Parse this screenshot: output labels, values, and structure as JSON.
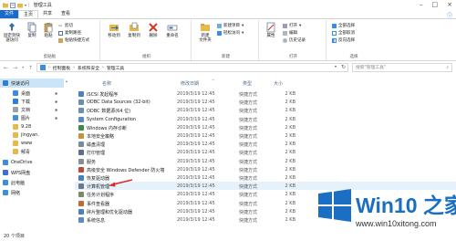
{
  "window": {
    "title": "管理工具"
  },
  "tabs": [
    {
      "label": "文件"
    },
    {
      "label": "主页"
    },
    {
      "label": "共享"
    },
    {
      "label": "查看"
    }
  ],
  "ribbon": {
    "pin_quick_access": "固定到快\n速访问",
    "copy": "复制",
    "paste": "粘贴",
    "cut": "剪切",
    "copy_path": "复制路径",
    "paste_shortcut": "粘贴快捷方式",
    "group_clipboard": "剪贴板",
    "move_to": "移动到",
    "copy_to": "复制到",
    "delete": "删除",
    "rename": "重命名",
    "group_organize": "组织",
    "new_folder": "新建\n文件夹",
    "new_item": "新建项目",
    "easy_access": "轻松访问",
    "group_new": "新建",
    "properties": "属性",
    "open": "打开",
    "edit": "编辑",
    "history": "历史记录",
    "group_open": "打开",
    "select_all": "全部选择",
    "select_none": "全部取消",
    "invert_selection": "反向选择",
    "group_select": "选择"
  },
  "address": {
    "crumbs": [
      "控制面板",
      "系统和安全",
      "管理工具"
    ]
  },
  "search": {
    "placeholder": "搜索\"管理工具\""
  },
  "nav_pane": [
    {
      "label": "快速访问",
      "selected": true,
      "icon": "star-icon",
      "color": "#2f80d1"
    },
    {
      "label": "桌面",
      "pinned": true,
      "icon": "desktop-icon",
      "color": "#3a8ee0"
    },
    {
      "label": "下载",
      "pinned": true,
      "icon": "download-icon",
      "color": "#2f80d1"
    },
    {
      "label": "文档",
      "pinned": true,
      "icon": "document-icon",
      "color": "#9aa3ad"
    },
    {
      "label": "图片",
      "pinned": true,
      "icon": "picture-icon",
      "color": "#4a90d0"
    },
    {
      "label": "9.28",
      "icon": "folder-icon",
      "color": "#e8b84a"
    },
    {
      "label": "jingyan.",
      "icon": "folder-icon",
      "color": "#e8b84a"
    },
    {
      "label": "www",
      "icon": "folder-icon",
      "color": "#e8b84a"
    },
    {
      "label": "郁青",
      "icon": "folder-icon",
      "color": "#e8b84a"
    },
    {
      "label": "OneDrive",
      "icon": "cloud-icon",
      "color": "#3a8ee0"
    },
    {
      "label": "WPS网盘",
      "icon": "cloud-icon",
      "color": "#3b6fd8"
    },
    {
      "label": "此电脑",
      "icon": "computer-icon",
      "color": "#3a8ee0"
    },
    {
      "label": "网络",
      "icon": "network-icon",
      "color": "#3a8ee0"
    }
  ],
  "columns": {
    "name": "名称",
    "date": "修改日期",
    "type": "类型",
    "size": "大小"
  },
  "files": [
    {
      "name": "iSCSI 发起程序",
      "date": "2019/3/19 12:45",
      "type": "快捷方式",
      "size": "2 KB",
      "color": "#4f7fbf"
    },
    {
      "name": "ODBC Data Sources (32-bit)",
      "date": "2019/3/19 12:45",
      "type": "快捷方式",
      "size": "2 KB",
      "color": "#6b8fb0"
    },
    {
      "name": "ODBC 数据源(64 位)",
      "date": "2019/3/19 12:45",
      "type": "快捷方式",
      "size": "2 KB",
      "color": "#6b8fb0"
    },
    {
      "name": "System Configuration",
      "date": "2019/3/19 12:45",
      "type": "快捷方式",
      "size": "2 KB",
      "color": "#5a89c4"
    },
    {
      "name": "Windows 内存诊断",
      "date": "2019/3/19 12:45",
      "type": "快捷方式",
      "size": "2 KB",
      "color": "#3f8a4e"
    },
    {
      "name": "本地安全策略",
      "date": "2019/3/19 12:45",
      "type": "快捷方式",
      "size": "2 KB",
      "color": "#c0983a"
    },
    {
      "name": "磁盘清理",
      "date": "2019/3/19 12:45",
      "type": "快捷方式",
      "size": "2 KB",
      "color": "#7a8a99"
    },
    {
      "name": "打印管理",
      "date": "2019/3/19 12:45",
      "type": "快捷方式",
      "size": "2 KB",
      "color": "#5a6f8a"
    },
    {
      "name": "服务",
      "date": "2019/3/19 12:45",
      "type": "快捷方式",
      "size": "2 KB",
      "color": "#8a8f96"
    },
    {
      "name": "高级安全 Windows Defender 防火墙",
      "date": "2019/3/19 12:45",
      "type": "快捷方式",
      "size": "2 KB",
      "color": "#b84d3a"
    },
    {
      "name": "恢复驱动器",
      "date": "2019/3/19 12:45",
      "type": "快捷方式",
      "size": "2 KB",
      "color": "#4a7fc0"
    },
    {
      "name": "计算机管理",
      "date": "2019/3/19 12:45",
      "type": "快捷方式",
      "size": "2 KB",
      "color": "#6a7a8a",
      "highlight": true
    },
    {
      "name": "任务计划程序",
      "date": "2019/3/19 12:45",
      "type": "快捷方式",
      "size": "2 KB",
      "color": "#7a8a6a"
    },
    {
      "name": "事件查看器",
      "date": "2019/3/19 12:45",
      "type": "快捷方式",
      "size": "2 KB",
      "color": "#c06a3a"
    },
    {
      "name": "碎片整理和优化驱动器",
      "date": "2019/3/19 12:45",
      "type": "快捷方式",
      "size": "2 KB",
      "color": "#4a7fc0"
    },
    {
      "name": "系统信息",
      "date": "2019/3/19 12:45",
      "type": "快捷方式",
      "size": "2 KB",
      "color": "#5a89c4"
    }
  ],
  "status": {
    "count": "20 个项目"
  },
  "watermark": {
    "brand_latin": "Win10",
    "brand_cjk": " 之家",
    "url": "www.win10xitong.com",
    "logo_color": "#1a6fc4"
  }
}
